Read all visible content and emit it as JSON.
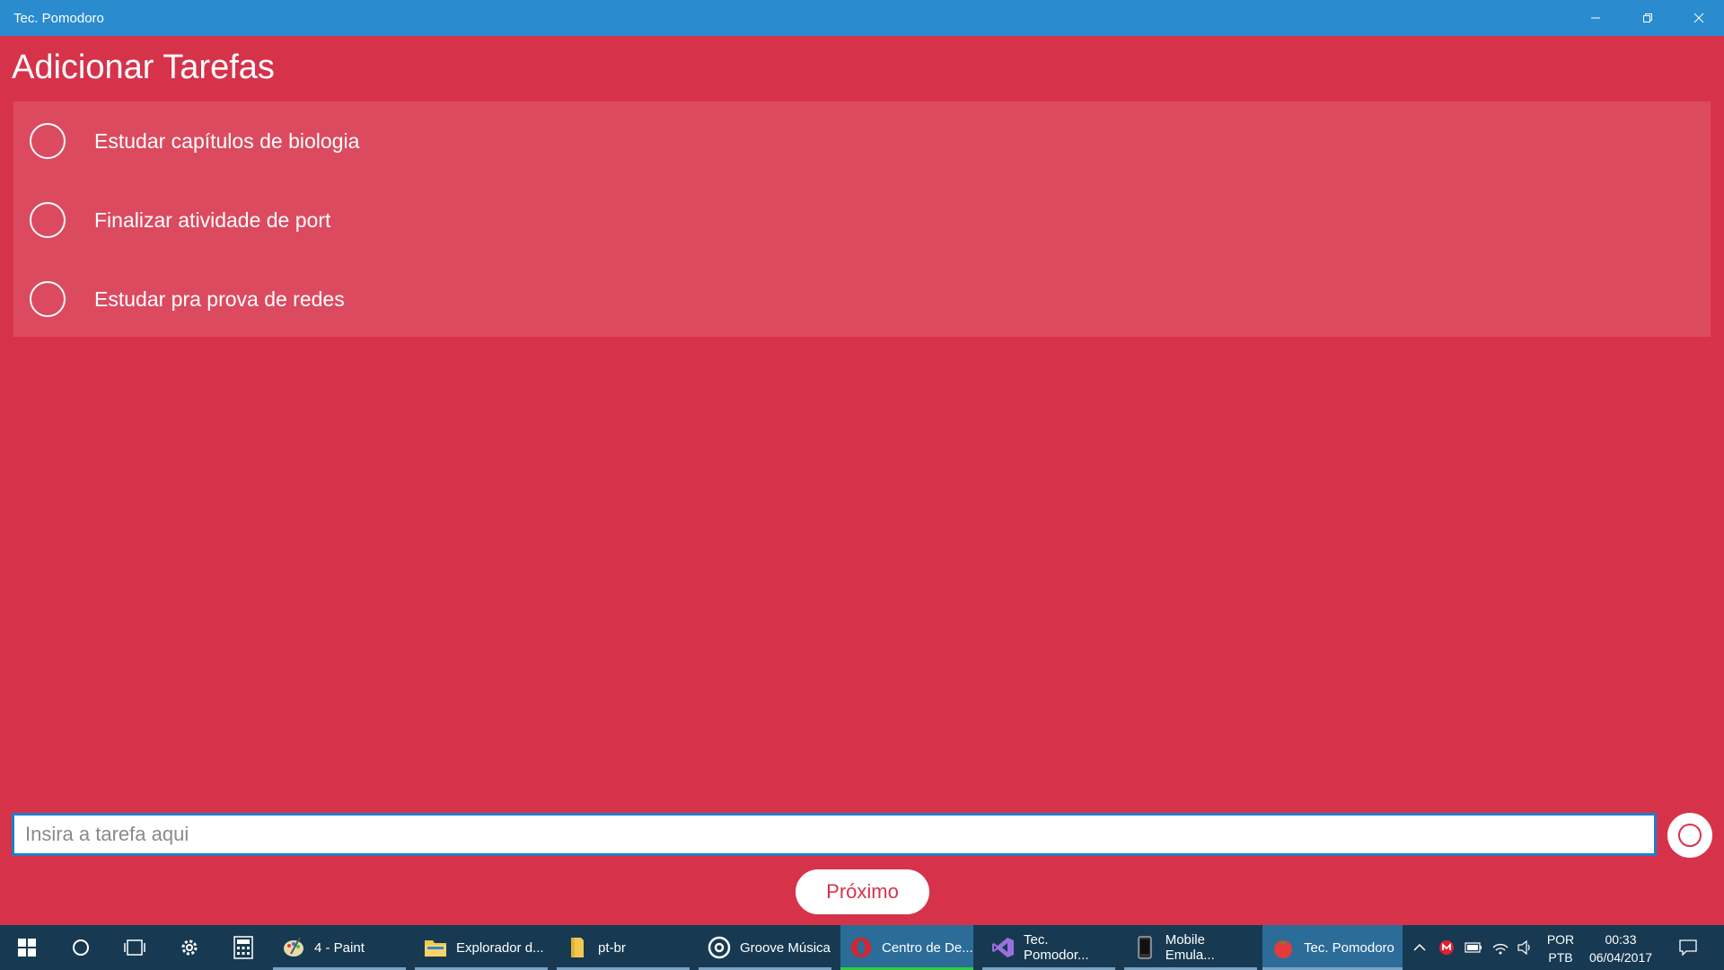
{
  "window": {
    "title": "Tec. Pomodoro",
    "controls": {
      "minimize": "minimize-icon",
      "maximize": "restore-icon",
      "close": "close-icon"
    }
  },
  "page": {
    "title": "Adicionar Tarefas",
    "tasks": [
      {
        "label": "Estudar capítulos de biologia",
        "checked": false
      },
      {
        "label": "Finalizar atividade de port",
        "checked": false
      },
      {
        "label": "Estudar pra prova de redes",
        "checked": false
      }
    ],
    "input": {
      "value": "",
      "placeholder": "Insira a tarefa aqui"
    },
    "next_button": "Próximo"
  },
  "colors": {
    "background": "#d6334b",
    "list_background": "#dc4a60",
    "titlebar": "#2a8bcf",
    "taskbar": "#173a52"
  },
  "taskbar": {
    "apps": [
      {
        "label": "4 - Paint",
        "icon": "paint-icon"
      },
      {
        "label": "Explorador d...",
        "icon": "folder-icon"
      },
      {
        "label": "pt-br",
        "icon": "folder-icon"
      },
      {
        "label": "Groove Música",
        "icon": "groove-icon"
      },
      {
        "label": "Centro de De...",
        "icon": "opera-icon"
      },
      {
        "label": "Tec. Pomodor...",
        "icon": "visual-studio-icon"
      },
      {
        "label": "Mobile Emula...",
        "icon": "phone-icon"
      },
      {
        "label": "Tec. Pomodoro",
        "icon": "tomato-icon"
      }
    ],
    "language": {
      "line1": "POR",
      "line2": "PTB"
    },
    "clock": {
      "time": "00:33",
      "date": "06/04/2017"
    }
  }
}
